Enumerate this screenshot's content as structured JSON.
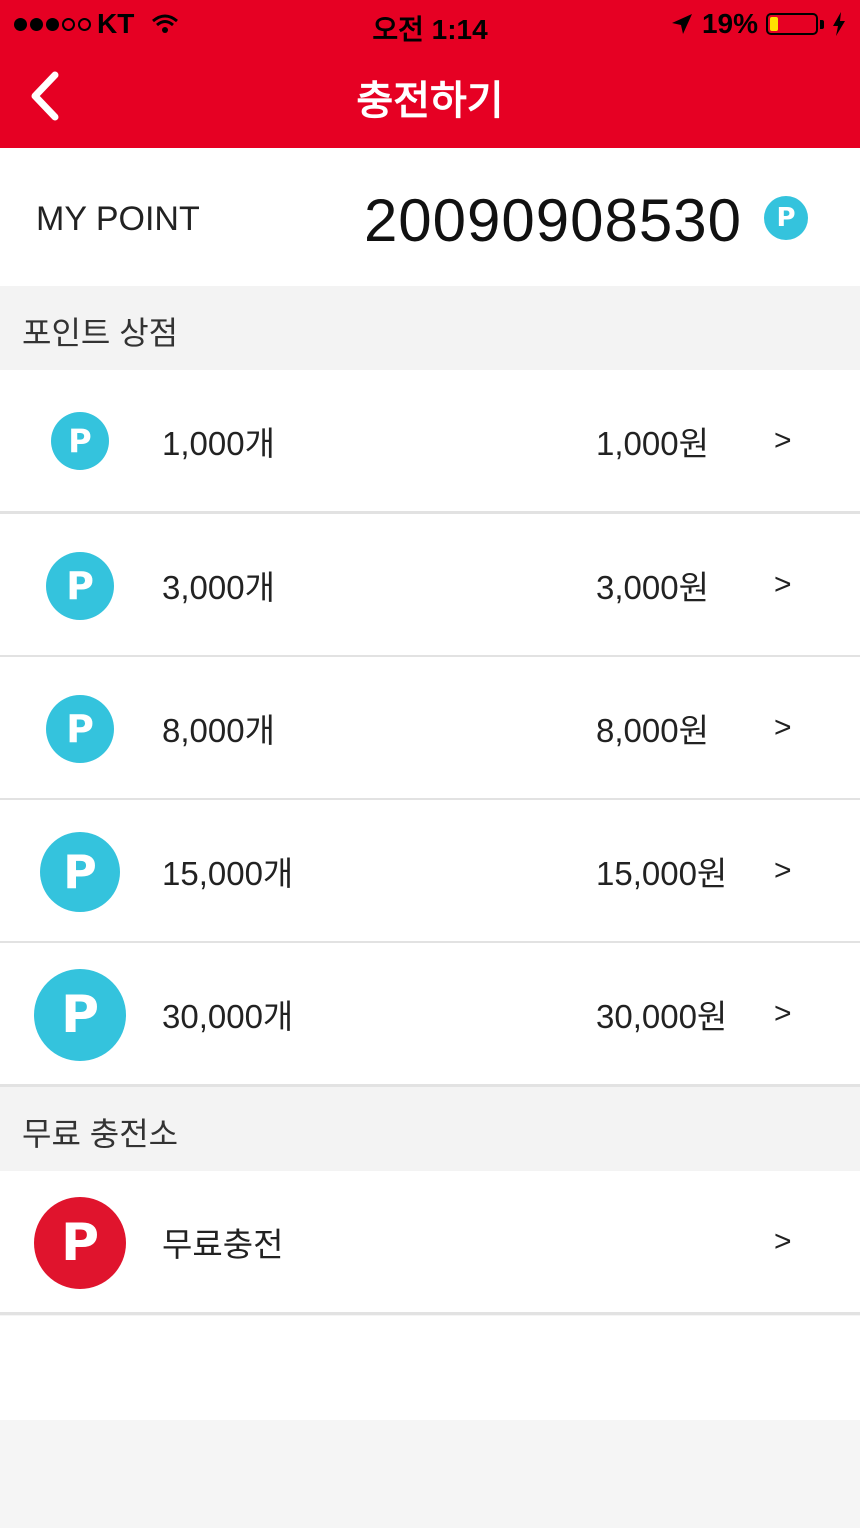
{
  "status_bar": {
    "carrier": "KT",
    "time": "오전 1:14",
    "battery": "19%",
    "battery_level": 0.19,
    "icons": [
      "signal-dots-icon",
      "wifi-icon",
      "location-arrow-icon",
      "battery-icon",
      "charging-bolt-icon"
    ]
  },
  "nav": {
    "title": "충전하기",
    "back_icon": "chevron-left-icon"
  },
  "my_point": {
    "label": "MY POINT",
    "value": "20090908530",
    "icon_letter": "P"
  },
  "point_store": {
    "title": "포인트 상점",
    "items": [
      {
        "amount": "1,000개",
        "price": "1,000원",
        "icon_letter": "P",
        "chevron": ">"
      },
      {
        "amount": "3,000개",
        "price": "3,000원",
        "icon_letter": "P",
        "chevron": ">"
      },
      {
        "amount": "8,000개",
        "price": "8,000원",
        "icon_letter": "P",
        "chevron": ">"
      },
      {
        "amount": "15,000개",
        "price": "15,000원",
        "icon_letter": "P",
        "chevron": ">"
      },
      {
        "amount": "30,000개",
        "price": "30,000원",
        "icon_letter": "P",
        "chevron": ">"
      }
    ]
  },
  "free_charge": {
    "title": "무료 충전소",
    "items": [
      {
        "label": "무료충전",
        "icon_letter": "P",
        "chevron": ">"
      }
    ]
  },
  "colors": {
    "header_red": "#e60023",
    "point_blue": "#34c3dd",
    "free_red": "#e0142d",
    "battery_yellow": "#ffe100"
  }
}
